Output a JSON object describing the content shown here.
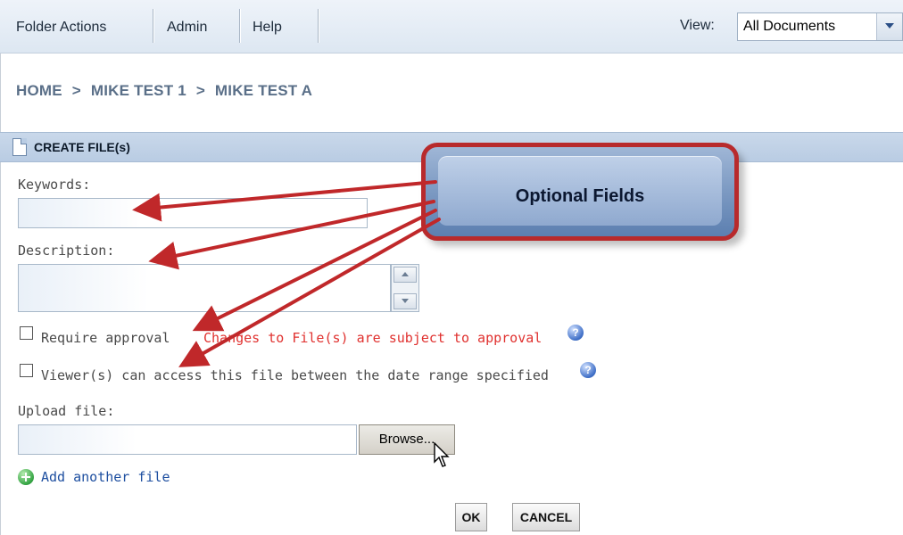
{
  "toolbar": {
    "menu": [
      "Folder Actions",
      "Admin",
      "Help"
    ],
    "view_label": "View:",
    "view_selected": "All Documents"
  },
  "breadcrumb": [
    "HOME",
    ">",
    "MIKE TEST 1",
    ">",
    "MIKE TEST A"
  ],
  "section": {
    "title": "CREATE FILE(s)"
  },
  "form": {
    "keywords_label": "Keywords:",
    "description_label": "Description:",
    "require_approval_label": "Require approval",
    "approval_note": "Changes to File(s) are subject to approval",
    "viewer_access_label": "Viewer(s) can access this file between the date range specified",
    "upload_label": "Upload file:",
    "browse_label": "Browse...",
    "add_another": "Add another file",
    "ok_label": "OK",
    "cancel_label": "CANCEL"
  },
  "callout": {
    "text": "Optional Fields"
  },
  "colors": {
    "callout_border": "#b82a2c",
    "note_red": "#e0312f",
    "header_blue": "#c9d8ea"
  }
}
